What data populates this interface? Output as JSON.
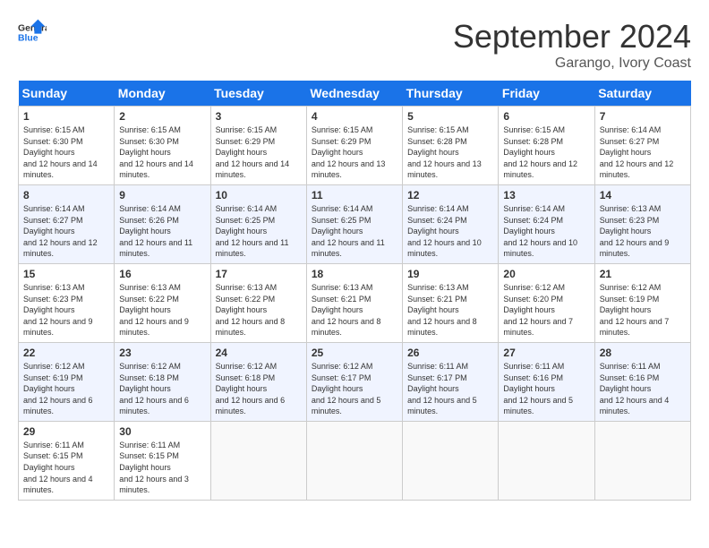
{
  "header": {
    "logo_line1": "General",
    "logo_line2": "Blue",
    "month": "September 2024",
    "location": "Garango, Ivory Coast"
  },
  "days_of_week": [
    "Sunday",
    "Monday",
    "Tuesday",
    "Wednesday",
    "Thursday",
    "Friday",
    "Saturday"
  ],
  "weeks": [
    [
      {
        "day": "1",
        "sunrise": "6:15 AM",
        "sunset": "6:30 PM",
        "daylight": "12 hours and 14 minutes."
      },
      {
        "day": "2",
        "sunrise": "6:15 AM",
        "sunset": "6:30 PM",
        "daylight": "12 hours and 14 minutes."
      },
      {
        "day": "3",
        "sunrise": "6:15 AM",
        "sunset": "6:29 PM",
        "daylight": "12 hours and 14 minutes."
      },
      {
        "day": "4",
        "sunrise": "6:15 AM",
        "sunset": "6:29 PM",
        "daylight": "12 hours and 13 minutes."
      },
      {
        "day": "5",
        "sunrise": "6:15 AM",
        "sunset": "6:28 PM",
        "daylight": "12 hours and 13 minutes."
      },
      {
        "day": "6",
        "sunrise": "6:15 AM",
        "sunset": "6:28 PM",
        "daylight": "12 hours and 12 minutes."
      },
      {
        "day": "7",
        "sunrise": "6:14 AM",
        "sunset": "6:27 PM",
        "daylight": "12 hours and 12 minutes."
      }
    ],
    [
      {
        "day": "8",
        "sunrise": "6:14 AM",
        "sunset": "6:27 PM",
        "daylight": "12 hours and 12 minutes."
      },
      {
        "day": "9",
        "sunrise": "6:14 AM",
        "sunset": "6:26 PM",
        "daylight": "12 hours and 11 minutes."
      },
      {
        "day": "10",
        "sunrise": "6:14 AM",
        "sunset": "6:25 PM",
        "daylight": "12 hours and 11 minutes."
      },
      {
        "day": "11",
        "sunrise": "6:14 AM",
        "sunset": "6:25 PM",
        "daylight": "12 hours and 11 minutes."
      },
      {
        "day": "12",
        "sunrise": "6:14 AM",
        "sunset": "6:24 PM",
        "daylight": "12 hours and 10 minutes."
      },
      {
        "day": "13",
        "sunrise": "6:14 AM",
        "sunset": "6:24 PM",
        "daylight": "12 hours and 10 minutes."
      },
      {
        "day": "14",
        "sunrise": "6:13 AM",
        "sunset": "6:23 PM",
        "daylight": "12 hours and 9 minutes."
      }
    ],
    [
      {
        "day": "15",
        "sunrise": "6:13 AM",
        "sunset": "6:23 PM",
        "daylight": "12 hours and 9 minutes."
      },
      {
        "day": "16",
        "sunrise": "6:13 AM",
        "sunset": "6:22 PM",
        "daylight": "12 hours and 9 minutes."
      },
      {
        "day": "17",
        "sunrise": "6:13 AM",
        "sunset": "6:22 PM",
        "daylight": "12 hours and 8 minutes."
      },
      {
        "day": "18",
        "sunrise": "6:13 AM",
        "sunset": "6:21 PM",
        "daylight": "12 hours and 8 minutes."
      },
      {
        "day": "19",
        "sunrise": "6:13 AM",
        "sunset": "6:21 PM",
        "daylight": "12 hours and 8 minutes."
      },
      {
        "day": "20",
        "sunrise": "6:12 AM",
        "sunset": "6:20 PM",
        "daylight": "12 hours and 7 minutes."
      },
      {
        "day": "21",
        "sunrise": "6:12 AM",
        "sunset": "6:19 PM",
        "daylight": "12 hours and 7 minutes."
      }
    ],
    [
      {
        "day": "22",
        "sunrise": "6:12 AM",
        "sunset": "6:19 PM",
        "daylight": "12 hours and 6 minutes."
      },
      {
        "day": "23",
        "sunrise": "6:12 AM",
        "sunset": "6:18 PM",
        "daylight": "12 hours and 6 minutes."
      },
      {
        "day": "24",
        "sunrise": "6:12 AM",
        "sunset": "6:18 PM",
        "daylight": "12 hours and 6 minutes."
      },
      {
        "day": "25",
        "sunrise": "6:12 AM",
        "sunset": "6:17 PM",
        "daylight": "12 hours and 5 minutes."
      },
      {
        "day": "26",
        "sunrise": "6:11 AM",
        "sunset": "6:17 PM",
        "daylight": "12 hours and 5 minutes."
      },
      {
        "day": "27",
        "sunrise": "6:11 AM",
        "sunset": "6:16 PM",
        "daylight": "12 hours and 5 minutes."
      },
      {
        "day": "28",
        "sunrise": "6:11 AM",
        "sunset": "6:16 PM",
        "daylight": "12 hours and 4 minutes."
      }
    ],
    [
      {
        "day": "29",
        "sunrise": "6:11 AM",
        "sunset": "6:15 PM",
        "daylight": "12 hours and 4 minutes."
      },
      {
        "day": "30",
        "sunrise": "6:11 AM",
        "sunset": "6:15 PM",
        "daylight": "12 hours and 3 minutes."
      },
      null,
      null,
      null,
      null,
      null
    ]
  ]
}
